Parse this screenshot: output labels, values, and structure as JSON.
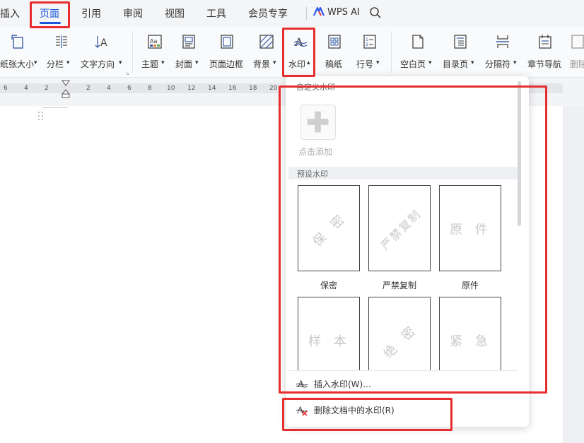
{
  "menubar": {
    "tabs": [
      {
        "label": "插入",
        "active": false
      },
      {
        "label": "页面",
        "active": true
      },
      {
        "label": "引用",
        "active": false
      },
      {
        "label": "审阅",
        "active": false
      },
      {
        "label": "视图",
        "active": false
      },
      {
        "label": "工具",
        "active": false
      },
      {
        "label": "会员专享",
        "active": false
      }
    ],
    "ai_label": "WPS AI"
  },
  "ribbon": {
    "paper_size": "纸张大小",
    "columns": "分栏",
    "text_direction": "文字方向",
    "theme": "主题",
    "cover": "封面",
    "page_border": "页面边框",
    "background": "背景",
    "watermark": "水印",
    "manuscript": "稿纸",
    "line_number": "行号",
    "blank_page": "空白页",
    "toc_page": "目录页",
    "separator": "分隔符",
    "chapter_nav": "章节导航",
    "delete": "删除"
  },
  "ruler": {
    "numbers": [
      "6",
      "4",
      "2",
      "2",
      "4",
      "6",
      "8",
      "10",
      "12",
      "14",
      "16",
      "18",
      "20"
    ]
  },
  "dropdown": {
    "custom_section": "自定义水印",
    "add_label": "点击添加",
    "preset_section": "预设水印",
    "presets": [
      {
        "text": "保 密",
        "label": "保密",
        "rotated": true
      },
      {
        "text": "严禁复制",
        "label": "严禁复制",
        "rotated": true
      },
      {
        "text": "原 件",
        "label": "原件",
        "rotated": false
      },
      {
        "text": "样 本",
        "label": "",
        "rotated": false
      },
      {
        "text": "绝 密",
        "label": "",
        "rotated": true
      },
      {
        "text": "紧 急",
        "label": "",
        "rotated": false
      }
    ],
    "insert_item": "插入水印(W)...",
    "delete_item": "删除文档中的水印(R)"
  },
  "colors": {
    "accent": "#1a56db",
    "highlight": "#e62e2e",
    "watermark_gray": "#c9c9c9"
  }
}
